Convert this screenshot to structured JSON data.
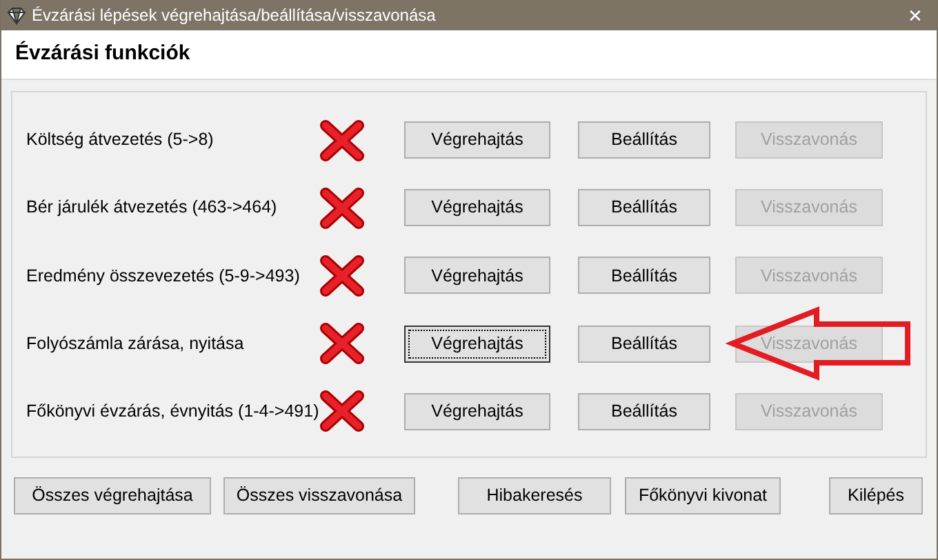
{
  "window": {
    "title": "Évzárási lépések végrehajtása/beállítása/visszavonása",
    "close": "✕"
  },
  "header": "Évzárási funkciók",
  "steps": [
    {
      "label": "Költség átvezetés (5->8)",
      "done": false,
      "buttons": [
        {
          "label": "Végrehajtás",
          "disabled": false,
          "focused": false
        },
        {
          "label": "Beállítás",
          "disabled": false,
          "focused": false
        },
        {
          "label": "Visszavonás",
          "disabled": true,
          "focused": false
        }
      ],
      "arrow": false
    },
    {
      "label": "Bér járulék átvezetés (463->464)",
      "done": false,
      "buttons": [
        {
          "label": "Végrehajtás",
          "disabled": false,
          "focused": false
        },
        {
          "label": "Beállítás",
          "disabled": false,
          "focused": false
        },
        {
          "label": "Visszavonás",
          "disabled": true,
          "focused": false
        }
      ],
      "arrow": false
    },
    {
      "label": "Eredmény összevezetés (5-9->493)",
      "done": false,
      "buttons": [
        {
          "label": "Végrehajtás",
          "disabled": false,
          "focused": false
        },
        {
          "label": "Beállítás",
          "disabled": false,
          "focused": false
        },
        {
          "label": "Visszavonás",
          "disabled": true,
          "focused": false
        }
      ],
      "arrow": false
    },
    {
      "label": "Folyószámla zárása, nyitása",
      "done": false,
      "buttons": [
        {
          "label": "Végrehajtás",
          "disabled": false,
          "focused": true
        },
        {
          "label": "Beállítás",
          "disabled": false,
          "focused": false
        },
        {
          "label": "Visszavonás",
          "disabled": true,
          "focused": false
        }
      ],
      "arrow": true
    },
    {
      "label": "Főkönyvi évzárás, évnyitás (1-4->491)",
      "done": false,
      "buttons": [
        {
          "label": "Végrehajtás",
          "disabled": false,
          "focused": false
        },
        {
          "label": "Beállítás",
          "disabled": false,
          "focused": false
        },
        {
          "label": "Visszavonás",
          "disabled": true,
          "focused": false
        }
      ],
      "arrow": false
    }
  ],
  "footer_buttons": [
    "Összes végrehajtása",
    "Összes visszavonása",
    "Hibakeresés",
    "Főkönyvi kivonat",
    "Kilépés"
  ]
}
